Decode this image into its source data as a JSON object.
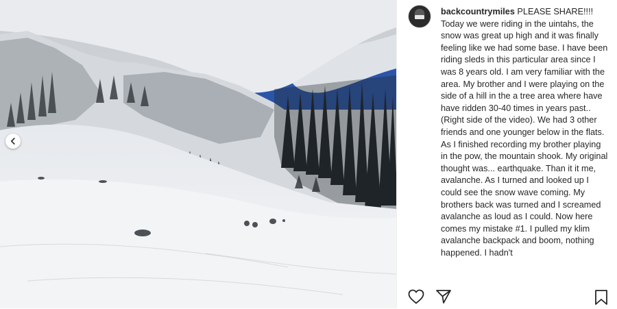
{
  "post": {
    "username": "backcountrymiles",
    "caption": "PLEASE SHARE!!!! Today we were riding in the uintahs, the snow was great up high and it was finally feeling like we had some base. I have been riding sleds in this particular area since I was 8 years old. I am very familiar with the area. My brother and I were playing on the side of a hill in the a tree area where have have ridden 30-40 times in years past.. (Right side of the video). We had 3 other friends and one younger below in the flats. As I finished recording my brother playing in the pow, the mountain shook. My original thought was... earthquake. Than it it me, avalanche. As I turned and looked up I could see the snow wave coming. My brothers back was turned and I screamed avalanche as loud as I could. Now here comes my mistake #1. I pulled my klim avalanche backpack and boom, nothing happened. I hadn't"
  },
  "photo": {
    "icon": "snowy-mountain-avalanche-photo"
  },
  "actions": {
    "like_icon": "heart-icon",
    "share_icon": "paper-plane-icon",
    "save_icon": "bookmark-icon"
  },
  "colors": {
    "text": "#262626",
    "sky": "#2b55a8",
    "snow": "#eef0f3"
  }
}
